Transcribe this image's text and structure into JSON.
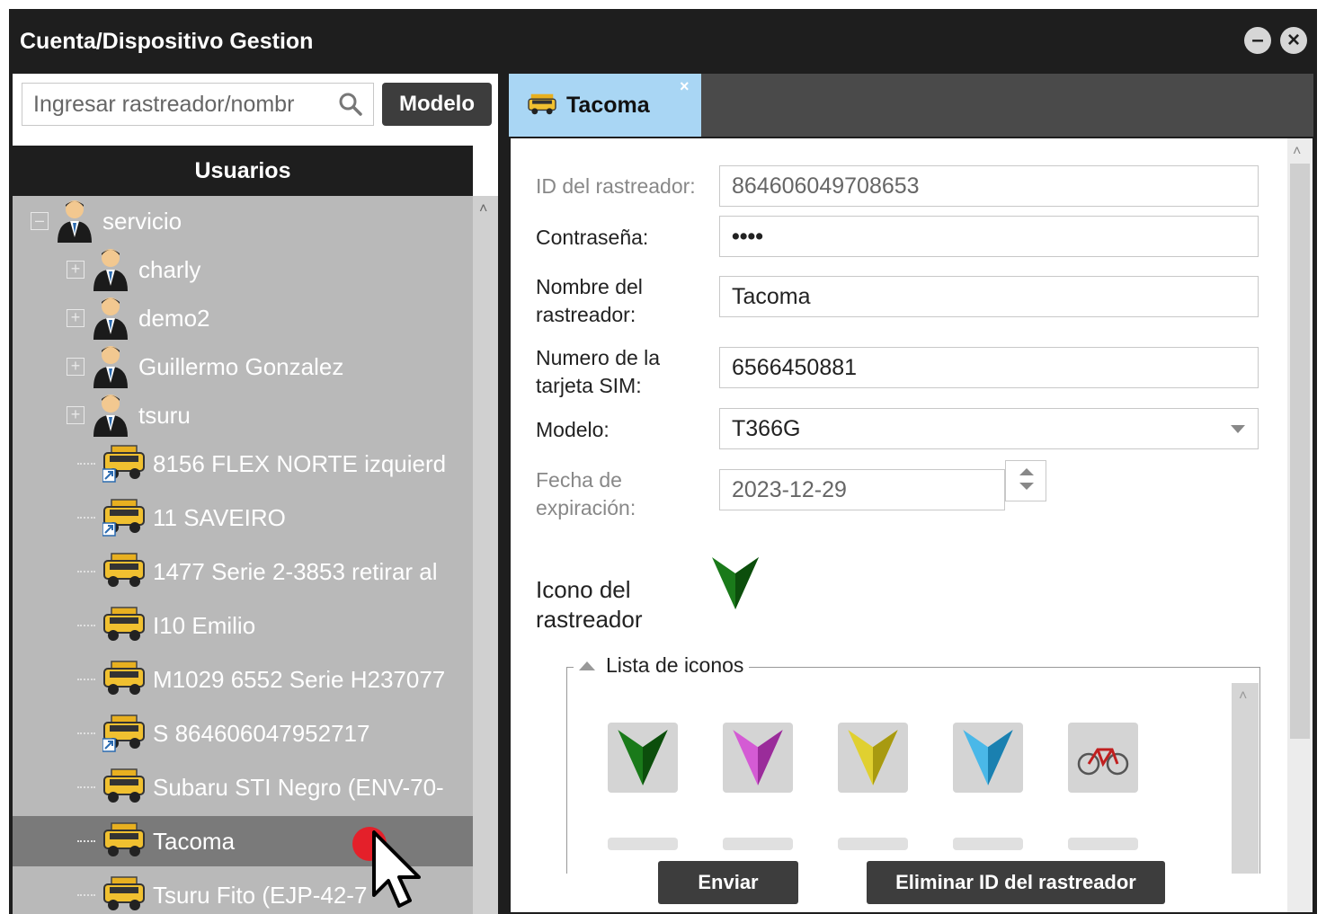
{
  "window": {
    "title": "Cuenta/Dispositivo Gestion"
  },
  "search": {
    "placeholder": "Ingresar rastreador/nombr",
    "model_button": "Modelo"
  },
  "users_header": "Usuarios",
  "tree": {
    "root": "servicio",
    "users": [
      "charly",
      "demo2",
      "Guillermo Gonzalez",
      "tsuru"
    ],
    "devices": [
      "8156 FLEX NORTE izquierd",
      "11 SAVEIRO",
      "1477 Serie 2-3853 retirar al",
      "I10 Emilio",
      "M1029 6552 Serie H237077",
      "S 864606047952717",
      "Subaru STI Negro (ENV-70-",
      "Tacoma",
      "Tsuru Fito (EJP-42-7"
    ],
    "selected": "Tacoma"
  },
  "tab": {
    "label": "Tacoma",
    "close": "×"
  },
  "form": {
    "tracker_id_label": "ID del rastreador:",
    "tracker_id_value": "864606049708653",
    "password_label": "Contraseña:",
    "password_value": "••••",
    "name_label_1": "Nombre del",
    "name_label_2": "rastreador:",
    "name_value": "Tacoma",
    "sim_label_1": "Numero de la",
    "sim_label_2": "tarjeta SIM:",
    "sim_value": "6566450881",
    "model_label": "Modelo:",
    "model_value": "T366G",
    "expiry_label_1": "Fecha de",
    "expiry_label_2": "expiración:",
    "expiry_value": "2023-12-29",
    "icon_label_1": "Icono del",
    "icon_label_2": "rastreador",
    "icon_list_legend": "Lista de iconos"
  },
  "icon_options": [
    "green-arrow",
    "magenta-arrow",
    "yellow-arrow",
    "blue-arrow",
    "bicycle"
  ],
  "buttons": {
    "submit": "Enviar",
    "delete": "Eliminar ID del rastreador"
  },
  "colors": {
    "titlebar": "#1e1e1e",
    "tab_active": "#a9d6f4",
    "tree_bg": "#b9b9b9",
    "selected_row": "#7a7a7a",
    "button": "#3d3d3d"
  }
}
